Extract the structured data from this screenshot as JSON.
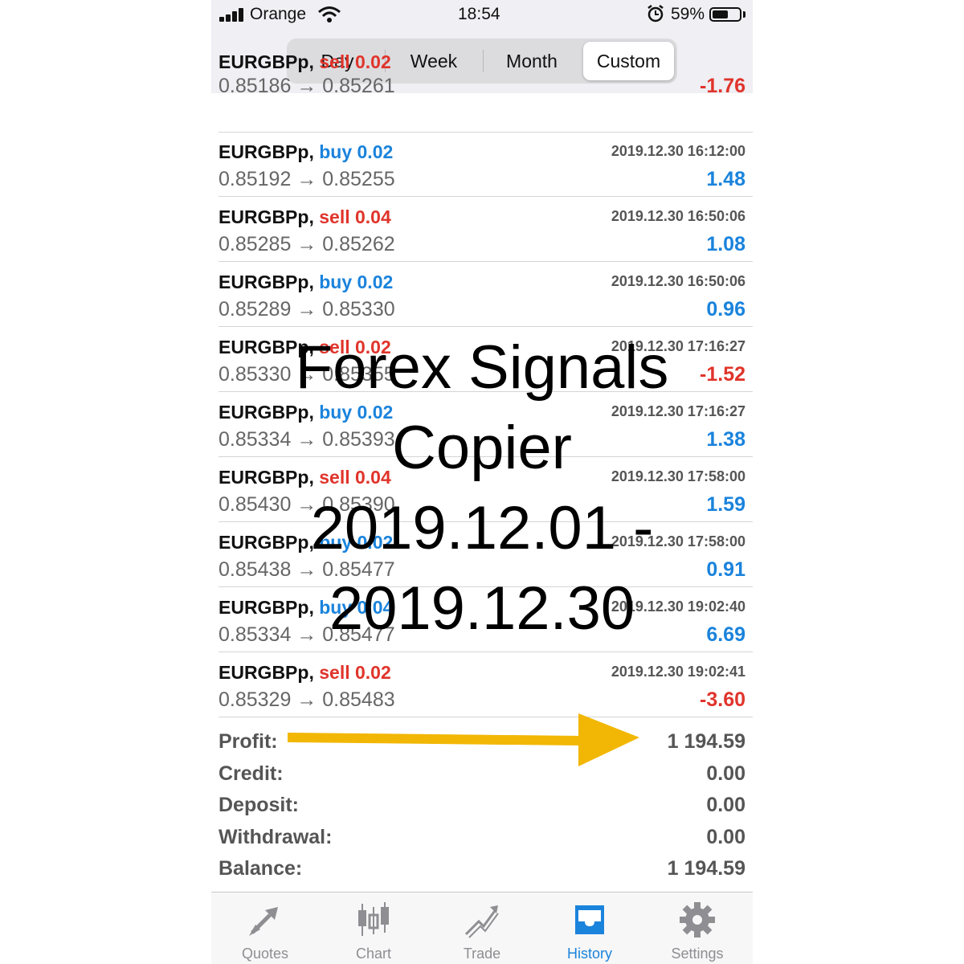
{
  "status_bar": {
    "carrier": "Orange",
    "time": "18:54",
    "battery": "59%",
    "battery_level": 0.59
  },
  "segments": [
    "Day",
    "Week",
    "Month",
    "Custom"
  ],
  "selected_segment": "Custom",
  "partial_row": {
    "symbol": "EURGBPp,",
    "side": "sell",
    "volume": "0.02",
    "prices": "0.85186 → 0.85261",
    "profit": "-1.76"
  },
  "deals": [
    {
      "symbol": "EURGBPp,",
      "side": "buy",
      "volume": "0.02",
      "date": "2019.12.30 16:12:00",
      "prices": "0.85192 → 0.85255",
      "profit": "1.48"
    },
    {
      "symbol": "EURGBPp,",
      "side": "sell",
      "volume": "0.04",
      "date": "2019.12.30 16:50:06",
      "prices": "0.85285 → 0.85262",
      "profit": "1.08"
    },
    {
      "symbol": "EURGBPp,",
      "side": "buy",
      "volume": "0.02",
      "date": "2019.12.30 16:50:06",
      "prices": "0.85289 → 0.85330",
      "profit": "0.96"
    },
    {
      "symbol": "EURGBPp,",
      "side": "sell",
      "volume": "0.02",
      "date": "2019.12.30 17:16:27",
      "prices": "0.85330 → 0.85355",
      "profit": "-1.52"
    },
    {
      "symbol": "EURGBPp,",
      "side": "buy",
      "volume": "0.02",
      "date": "2019.12.30 17:16:27",
      "prices": "0.85334 → 0.85393",
      "profit": "1.38"
    },
    {
      "symbol": "EURGBPp,",
      "side": "sell",
      "volume": "0.04",
      "date": "2019.12.30 17:58:00",
      "prices": "0.85430 → 0.85390",
      "profit": "1.59"
    },
    {
      "symbol": "EURGBPp,",
      "side": "buy",
      "volume": "0.02",
      "date": "2019.12.30 17:58:00",
      "prices": "0.85438 → 0.85477",
      "profit": "0.91"
    },
    {
      "symbol": "EURGBPp,",
      "side": "buy",
      "volume": "0.04",
      "date": "2019.12.30 19:02:40",
      "prices": "0.85334 → 0.85477",
      "profit": "6.69"
    },
    {
      "symbol": "EURGBPp,",
      "side": "sell",
      "volume": "0.02",
      "date": "2019.12.30 19:02:41",
      "prices": "0.85329 → 0.85483",
      "profit": "-3.60"
    }
  ],
  "summary": {
    "profit_label": "Profit:",
    "profit": "1 194.59",
    "credit_label": "Credit:",
    "credit": "0.00",
    "deposit_label": "Deposit:",
    "deposit": "0.00",
    "withdrawal_label": "Withdrawal:",
    "withdrawal": "0.00",
    "balance_label": "Balance:",
    "balance": "1 194.59"
  },
  "tabs": [
    {
      "label": "Quotes",
      "icon": "quotes-arrows-icon"
    },
    {
      "label": "Chart",
      "icon": "candlestick-chart-icon"
    },
    {
      "label": "Trade",
      "icon": "trade-trend-icon"
    },
    {
      "label": "History",
      "icon": "history-inbox-icon"
    },
    {
      "label": "Settings",
      "icon": "gear-icon"
    }
  ],
  "active_tab": "History",
  "overlay_text": {
    "line1": "Forex Signals",
    "line2": "Copier",
    "line3": "2019.12.01 -",
    "line4": "2019.12.30"
  },
  "colors": {
    "buy": "#1a83dc",
    "sell": "#e0342b",
    "arrow": "#f2b705",
    "tab_active": "#1a83dc"
  }
}
